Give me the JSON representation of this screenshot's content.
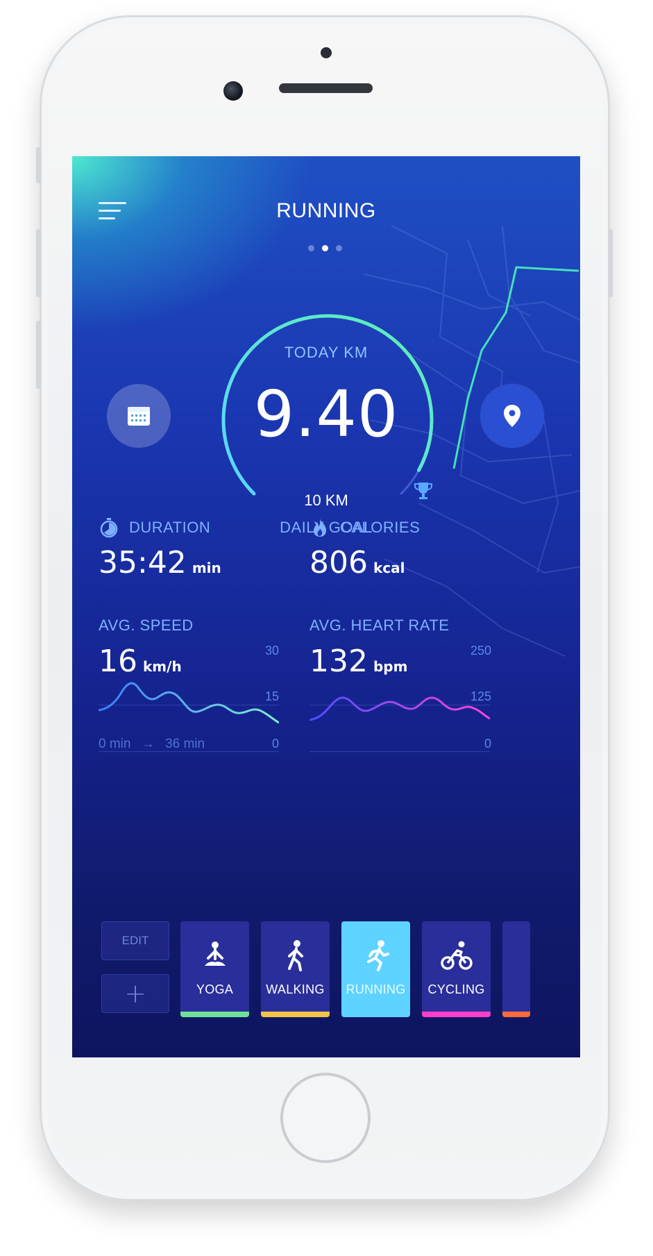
{
  "header": {
    "title": "RUNNING",
    "page_count": 3,
    "active_page": 2
  },
  "today": {
    "label": "TODAY KM",
    "value": "9.40",
    "goal_value": "10 KM",
    "goal_label": "DAILY GOAL",
    "progress_fraction": 0.94
  },
  "stats": {
    "duration": {
      "label": "DURATION",
      "value": "35:42",
      "unit": "min"
    },
    "calories": {
      "label": "CALORIES",
      "value": "806",
      "unit": "kcal"
    },
    "speed": {
      "label": "AVG. SPEED",
      "value": "16",
      "unit": "km/h",
      "axis_top": "30",
      "axis_mid": "15",
      "axis_bottom": "0",
      "range_start": "0 min",
      "range_arrow": "→",
      "range_end": "36 min"
    },
    "heart": {
      "label": "AVG. HEART RATE",
      "value": "132",
      "unit": "bpm",
      "axis_top": "250",
      "axis_mid": "125",
      "axis_bottom": "0"
    }
  },
  "activity_bar": {
    "edit_label": "EDIT",
    "add_label": "+",
    "tiles": [
      {
        "label": "YOGA",
        "icon": "yoga-icon",
        "accent": "#6fe09a"
      },
      {
        "label": "WALKING",
        "icon": "walking-icon",
        "accent": "#f4c44a"
      },
      {
        "label": "RUNNING",
        "icon": "running-icon",
        "accent": "#5fd3ff",
        "active": true
      },
      {
        "label": "CYCLING",
        "icon": "cycling-icon",
        "accent": "#ff3fc8"
      }
    ],
    "partial_tile_accent": "#ff6a3a"
  },
  "colors": {
    "gauge_start": "#5ad6ff",
    "gauge_end": "#5ff0b0",
    "label_blue": "#7fb0ff",
    "speed_line_start": "#3a7cff",
    "speed_line_end": "#7ff0d0",
    "heart_line_start": "#4a4dff",
    "heart_line_end": "#ff45d8"
  }
}
